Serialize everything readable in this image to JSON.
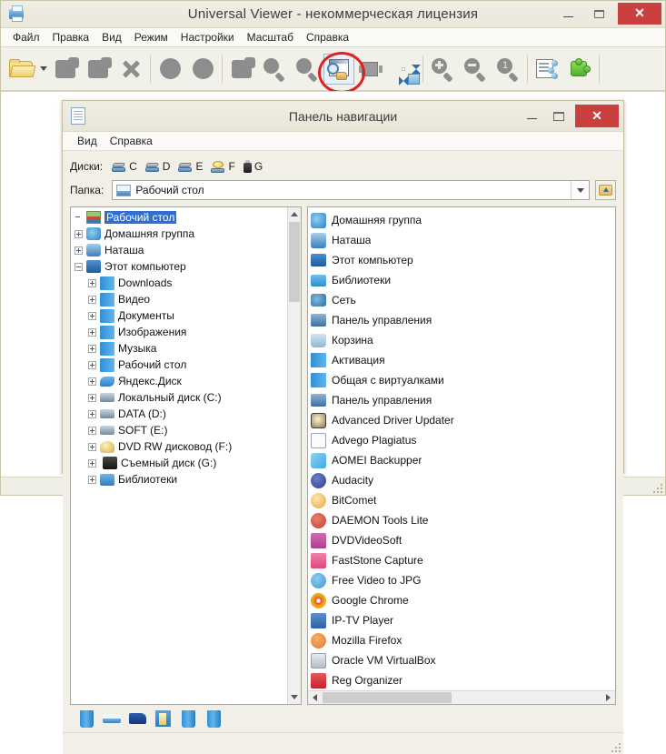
{
  "window": {
    "title": "Universal Viewer - некоммерческая лицензия",
    "app_icon": "printer-icon",
    "minimize": "–",
    "maximize": "□",
    "close": "✕"
  },
  "menubar": {
    "items": [
      {
        "label": "Файл"
      },
      {
        "label": "Правка"
      },
      {
        "label": "Вид"
      },
      {
        "label": "Режим"
      },
      {
        "label": "Настройки"
      },
      {
        "label": "Масштаб"
      },
      {
        "label": "Справка"
      }
    ]
  },
  "toolbar": {
    "items": [
      {
        "name": "open-folder-button",
        "icon": "open-folder-icon",
        "state": "enabled"
      },
      {
        "name": "open-folder-dropdown",
        "icon": "chevron-down-icon",
        "state": "enabled"
      },
      {
        "name": "previous-file-button",
        "icon": "previous-file-icon",
        "state": "disabled"
      },
      {
        "name": "next-file-button",
        "icon": "next-file-icon",
        "state": "disabled"
      },
      {
        "name": "delete-button",
        "icon": "close-x-icon",
        "state": "disabled"
      },
      {
        "name": "rotate-left-button",
        "icon": "rotate-left-icon",
        "state": "disabled"
      },
      {
        "name": "rotate-right-button",
        "icon": "rotate-right-icon",
        "state": "disabled"
      },
      {
        "name": "copy-button",
        "icon": "copy-icon",
        "state": "disabled"
      },
      {
        "name": "find-button",
        "icon": "magnifier-icon",
        "state": "disabled"
      },
      {
        "name": "find-next-button",
        "icon": "magnifier-next-icon",
        "state": "disabled"
      },
      {
        "name": "navigation-panel-button",
        "icon": "navigation-panel-icon",
        "state": "active"
      },
      {
        "name": "filmstrip-button",
        "icon": "filmstrip-icon",
        "state": "disabled"
      },
      {
        "name": "pan-button",
        "icon": "pan-icon",
        "state": "enabled"
      },
      {
        "name": "zoom-in-button",
        "icon": "zoom-in-icon",
        "state": "disabled"
      },
      {
        "name": "zoom-out-button",
        "icon": "zoom-out-icon",
        "state": "disabled"
      },
      {
        "name": "zoom-actual-button",
        "icon": "zoom-actual-icon",
        "state": "disabled"
      },
      {
        "name": "properties-button",
        "icon": "properties-icon",
        "state": "enabled"
      },
      {
        "name": "plugins-button",
        "icon": "plugin-icon",
        "state": "enabled"
      }
    ],
    "annotation": {
      "shape": "ellipse",
      "color": "#e02020",
      "target": "navigation-panel-button"
    }
  },
  "dialog": {
    "title": "Панель навигации",
    "icon": "document-icon",
    "minimize": "–",
    "maximize": "□",
    "close": "✕",
    "menubar": [
      {
        "label": "Вид"
      },
      {
        "label": "Справка"
      }
    ],
    "drives": {
      "label": "Диски:",
      "items": [
        {
          "letter": "C",
          "icon": "hard-drive-icon"
        },
        {
          "letter": "D",
          "icon": "hard-drive-icon"
        },
        {
          "letter": "E",
          "icon": "hard-drive-icon"
        },
        {
          "letter": "F",
          "icon": "cd-drive-icon"
        },
        {
          "letter": "G",
          "icon": "usb-drive-icon"
        }
      ]
    },
    "folder": {
      "label": "Папка:",
      "value": "Рабочий стол",
      "icon": "desktop-icon",
      "dropdown_icon": "chevron-down-icon",
      "up_button_icon": "up-folder-icon"
    },
    "tree": {
      "nodes": [
        {
          "label": "Рабочий стол",
          "indent": 0,
          "expander": "none",
          "icon": "desktop-icon",
          "selected": true,
          "color": "#3c8a3c"
        },
        {
          "label": "Домашняя группа",
          "indent": 0,
          "expander": "plus",
          "icon": "homegroup-icon",
          "selected": false,
          "color": "#2f7fc4"
        },
        {
          "label": "Наташа",
          "indent": 0,
          "expander": "plus",
          "icon": "user-icon",
          "selected": false,
          "color": "#3b7fbc"
        },
        {
          "label": "Этот компьютер",
          "indent": 0,
          "expander": "minus",
          "icon": "computer-icon",
          "selected": false,
          "color": "#1d5a9e"
        },
        {
          "label": "Downloads",
          "indent": 1,
          "expander": "plus",
          "icon": "downloads-icon",
          "selected": false,
          "color": "#3f9ad6"
        },
        {
          "label": "Видео",
          "indent": 1,
          "expander": "plus",
          "icon": "video-icon",
          "selected": false,
          "color": "#3f9ad6"
        },
        {
          "label": "Документы",
          "indent": 1,
          "expander": "plus",
          "icon": "documents-icon",
          "selected": false,
          "color": "#3f9ad6"
        },
        {
          "label": "Изображения",
          "indent": 1,
          "expander": "plus",
          "icon": "pictures-icon",
          "selected": false,
          "color": "#3f9ad6"
        },
        {
          "label": "Музыка",
          "indent": 1,
          "expander": "plus",
          "icon": "music-icon",
          "selected": false,
          "color": "#3f9ad6"
        },
        {
          "label": "Рабочий стол",
          "indent": 1,
          "expander": "plus",
          "icon": "desktop-icon",
          "selected": false,
          "color": "#3f9ad6"
        },
        {
          "label": "Яндекс.Диск",
          "indent": 1,
          "expander": "plus",
          "icon": "yandex-disk-icon",
          "selected": false,
          "color": "#2f7fc4"
        },
        {
          "label": "Локальный диск (C:)",
          "indent": 1,
          "expander": "plus",
          "icon": "hard-drive-icon",
          "selected": false,
          "color": "#6f8ba3"
        },
        {
          "label": "DATA (D:)",
          "indent": 1,
          "expander": "plus",
          "icon": "hard-drive-icon",
          "selected": false,
          "color": "#6f8ba3"
        },
        {
          "label": "SOFT (E:)",
          "indent": 1,
          "expander": "plus",
          "icon": "hard-drive-icon",
          "selected": false,
          "color": "#6f8ba3"
        },
        {
          "label": "DVD RW дисковод (F:)",
          "indent": 1,
          "expander": "plus",
          "icon": "cd-drive-icon",
          "selected": false,
          "color": "#d8b040"
        },
        {
          "label": "Съемный диск (G:)",
          "indent": 1,
          "expander": "plus",
          "icon": "usb-drive-icon",
          "selected": false,
          "color": "#2b2b2b"
        },
        {
          "label": "Библиотеки",
          "indent": 1,
          "expander": "plus",
          "icon": "libraries-icon",
          "selected": false,
          "color": "#2f7fc4"
        }
      ],
      "scrollbar": {
        "orientation": "vertical",
        "thumb_position": "top"
      }
    },
    "list": {
      "column_1": [
        {
          "label": "Домашняя группа",
          "icon": "homegroup-icon",
          "color": "#2f7fc4"
        },
        {
          "label": "Наташа",
          "icon": "user-icon",
          "color": "#3b7fbc"
        },
        {
          "label": "Этот компьютер",
          "icon": "computer-icon",
          "color": "#1d5a9e"
        },
        {
          "label": "Библиотеки",
          "icon": "libraries-icon",
          "color": "#2f8fc8"
        },
        {
          "label": "Сеть",
          "icon": "network-icon",
          "color": "#2f6f9e"
        },
        {
          "label": "Панель управления",
          "icon": "control-panel-icon",
          "color": "#4a7fae"
        },
        {
          "label": "Корзина",
          "icon": "recycle-bin-icon",
          "color": "#9fc2d8"
        },
        {
          "label": "Активация",
          "icon": "folder-icon",
          "color": "#3f9ad6"
        },
        {
          "label": "Общая с виртуалками",
          "icon": "folder-icon",
          "color": "#3f9ad6"
        },
        {
          "label": "Панель управления",
          "icon": "control-panel-icon",
          "color": "#4a7fae"
        },
        {
          "label": "Advanced Driver Updater",
          "icon": "app-icon",
          "color": "#4a4a4a"
        },
        {
          "label": "Advego Plagiatus",
          "icon": "app-icon",
          "color": "#f0f0f0"
        }
      ],
      "column_2": [
        {
          "label": "AOMEI Backupper",
          "icon": "app-icon",
          "color": "#3fa9e0"
        },
        {
          "label": "Audacity",
          "icon": "app-icon",
          "color": "#2b3f8c"
        },
        {
          "label": "BitComet",
          "icon": "app-icon",
          "color": "#e8a83c"
        },
        {
          "label": "DAEMON Tools Lite",
          "icon": "app-icon",
          "color": "#c43f2f"
        },
        {
          "label": "DVDVideoSoft",
          "icon": "app-icon",
          "color": "#b03f8c"
        },
        {
          "label": "FastStone Capture",
          "icon": "app-icon",
          "color": "#e0487c"
        },
        {
          "label": "Free Video to JPG",
          "icon": "app-icon",
          "color": "#3f9ad6"
        },
        {
          "label": "Google Chrome",
          "icon": "app-icon",
          "color": "#dd5144"
        },
        {
          "label": "IP-TV Player",
          "icon": "app-icon",
          "color": "#2b5fa8"
        },
        {
          "label": "Mozilla Firefox",
          "icon": "app-icon",
          "color": "#e8772c"
        },
        {
          "label": "Oracle VM VirtualBox",
          "icon": "app-icon",
          "color": "#b9bcc0"
        },
        {
          "label": "Reg Organizer",
          "icon": "app-icon",
          "color": "#d8343c"
        }
      ],
      "scrollbar": {
        "orientation": "horizontal",
        "thumb_position": "left"
      }
    },
    "shortcuts": [
      {
        "name": "shortcut-desktop",
        "icon": "folder-blue-icon"
      },
      {
        "name": "shortcut-documents",
        "icon": "folder-flat-icon"
      },
      {
        "name": "shortcut-computer",
        "icon": "folder-dark-icon"
      },
      {
        "name": "shortcut-pictures",
        "icon": "folder-open-icon"
      },
      {
        "name": "shortcut-downloads",
        "icon": "folder-blue-icon"
      },
      {
        "name": "shortcut-music",
        "icon": "folder-blue-icon"
      }
    ],
    "resize_grip": "resize-grip-icon"
  },
  "statusbar": {
    "segments": [
      "",
      "",
      "",
      "",
      ""
    ],
    "resize_grip": "resize-grip-icon"
  }
}
